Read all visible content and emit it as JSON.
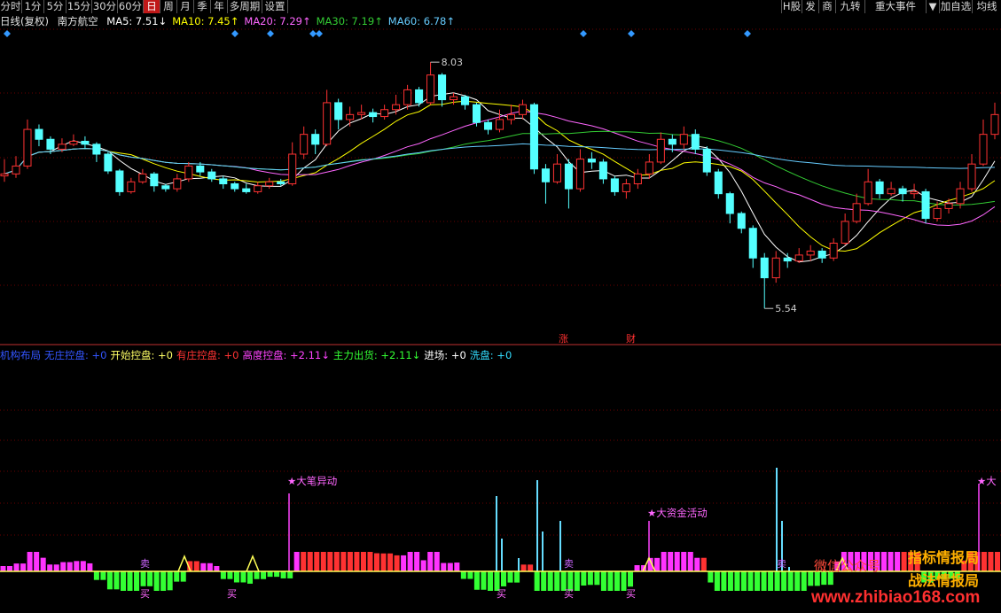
{
  "toolbar": {
    "left": [
      "分时",
      "1分",
      "5分",
      "15分",
      "30分",
      "60分",
      "日",
      "周",
      "月",
      "季",
      "年",
      "多周期",
      "设置"
    ],
    "active": "日",
    "right": [
      "H股",
      "发",
      "商",
      "九转",
      "重大事件",
      "▼",
      "加自选",
      "均线"
    ]
  },
  "ma_line": {
    "period": "日线(复权)",
    "stock": "南方航空",
    "items": [
      {
        "label": "MA5: 7.51↓",
        "color": "#ffffff"
      },
      {
        "label": "MA10: 7.45↑",
        "color": "#ffff00"
      },
      {
        "label": "MA20: 7.29↑",
        "color": "#ff66ff"
      },
      {
        "label": "MA30: 7.19↑",
        "color": "#33cc33"
      },
      {
        "label": "MA60: 6.78↑",
        "color": "#66ccff"
      }
    ]
  },
  "indicator_line": [
    {
      "label": "机构布局",
      "color": "#3355ff"
    },
    {
      "label": "无庄控盘: +0",
      "color": "#3355ff"
    },
    {
      "label": "开始控盘: +0",
      "color": "#ffff66"
    },
    {
      "label": "有庄控盘: +0",
      "color": "#ff3333"
    },
    {
      "label": "高度控盘: +2.11↓",
      "color": "#ff44ff"
    },
    {
      "label": "主力出货: +2.11↓",
      "color": "#33ff33"
    },
    {
      "label": "进场: +0",
      "color": "#ffffff"
    },
    {
      "label": "洗盘: +0",
      "color": "#33ddff"
    }
  ],
  "chart_data": {
    "type": "candlestick",
    "price_high_label": "8.03",
    "price_low_label": "5.54",
    "y_range": [
      5.3,
      8.3
    ],
    "colors": {
      "up": "#ff3232",
      "down": "#54ffff",
      "ma5": "#ffffff",
      "ma10": "#ffff00",
      "ma20": "#ff66ff",
      "ma30": "#33cc33",
      "ma60": "#66ccff"
    },
    "candles": [
      [
        6.88,
        6.9,
        7.05,
        6.82
      ],
      [
        6.9,
        6.98,
        7.08,
        6.86
      ],
      [
        6.98,
        7.35,
        7.45,
        6.95
      ],
      [
        7.35,
        7.25,
        7.4,
        7.18
      ],
      [
        7.25,
        7.15,
        7.28,
        7.1
      ],
      [
        7.15,
        7.2,
        7.26,
        7.12
      ],
      [
        7.2,
        7.23,
        7.3,
        7.18
      ],
      [
        7.23,
        7.2,
        7.28,
        7.15
      ],
      [
        7.2,
        7.1,
        7.22,
        7.02
      ],
      [
        7.1,
        6.93,
        7.12,
        6.9
      ],
      [
        6.93,
        6.72,
        6.95,
        6.68
      ],
      [
        6.72,
        6.82,
        6.86,
        6.7
      ],
      [
        6.82,
        6.9,
        6.95,
        6.8
      ],
      [
        6.9,
        6.78,
        6.92,
        6.72
      ],
      [
        6.78,
        6.75,
        6.8,
        6.72
      ],
      [
        6.75,
        6.85,
        6.9,
        6.72
      ],
      [
        6.85,
        6.98,
        7.02,
        6.82
      ],
      [
        6.98,
        6.92,
        7.02,
        6.88
      ],
      [
        6.92,
        6.85,
        6.95,
        6.82
      ],
      [
        6.85,
        6.8,
        6.88,
        6.75
      ],
      [
        6.8,
        6.75,
        6.82,
        6.72
      ],
      [
        6.75,
        6.72,
        6.8,
        6.7
      ],
      [
        6.72,
        6.78,
        6.82,
        6.7
      ],
      [
        6.78,
        6.82,
        6.86,
        6.75
      ],
      [
        6.82,
        6.8,
        6.85,
        6.78
      ],
      [
        6.8,
        7.1,
        7.22,
        6.78
      ],
      [
        7.1,
        7.3,
        7.38,
        7.05
      ],
      [
        7.3,
        7.2,
        7.35,
        7.1
      ],
      [
        7.2,
        7.62,
        7.75,
        7.18
      ],
      [
        7.62,
        7.45,
        7.66,
        7.35
      ],
      [
        7.45,
        7.5,
        7.58,
        7.38
      ],
      [
        7.5,
        7.52,
        7.6,
        7.45
      ],
      [
        7.52,
        7.48,
        7.56,
        7.42
      ],
      [
        7.48,
        7.55,
        7.6,
        7.45
      ],
      [
        7.55,
        7.6,
        7.7,
        7.5
      ],
      [
        7.6,
        7.75,
        7.8,
        7.55
      ],
      [
        7.75,
        7.62,
        7.78,
        7.58
      ],
      [
        7.62,
        7.9,
        8.03,
        7.6
      ],
      [
        7.9,
        7.65,
        7.92,
        7.58
      ],
      [
        7.65,
        7.68,
        7.72,
        7.6
      ],
      [
        7.68,
        7.6,
        7.7,
        7.55
      ],
      [
        7.6,
        7.42,
        7.62,
        7.38
      ],
      [
        7.42,
        7.35,
        7.45,
        7.3
      ],
      [
        7.35,
        7.45,
        7.55,
        7.32
      ],
      [
        7.45,
        7.5,
        7.6,
        7.4
      ],
      [
        7.5,
        7.6,
        7.65,
        7.45
      ],
      [
        7.6,
        6.95,
        7.62,
        6.9
      ],
      [
        6.95,
        6.82,
        7.0,
        6.6
      ],
      [
        6.82,
        7.0,
        7.1,
        6.8
      ],
      [
        7.0,
        6.75,
        7.05,
        6.55
      ],
      [
        6.75,
        7.05,
        7.15,
        6.72
      ],
      [
        7.05,
        7.02,
        7.12,
        6.95
      ],
      [
        7.02,
        6.85,
        7.05,
        6.8
      ],
      [
        6.85,
        6.72,
        6.88,
        6.68
      ],
      [
        6.72,
        6.8,
        6.85,
        6.65
      ],
      [
        6.8,
        6.9,
        6.95,
        6.75
      ],
      [
        6.9,
        7.02,
        7.1,
        6.85
      ],
      [
        7.02,
        7.25,
        7.32,
        7.0
      ],
      [
        7.25,
        7.2,
        7.3,
        7.12
      ],
      [
        7.2,
        7.3,
        7.38,
        7.15
      ],
      [
        7.3,
        7.15,
        7.35,
        7.1
      ],
      [
        7.15,
        6.92,
        7.18,
        6.88
      ],
      [
        6.92,
        6.7,
        6.95,
        6.65
      ],
      [
        6.7,
        6.5,
        6.72,
        6.4
      ],
      [
        6.5,
        6.35,
        6.52,
        6.3
      ],
      [
        6.35,
        6.05,
        6.38,
        5.95
      ],
      [
        6.05,
        5.85,
        6.1,
        5.54
      ],
      [
        5.85,
        6.05,
        6.12,
        5.8
      ],
      [
        6.05,
        6.02,
        6.1,
        5.95
      ],
      [
        6.02,
        6.08,
        6.15,
        6.0
      ],
      [
        6.08,
        6.12,
        6.18,
        6.02
      ],
      [
        6.12,
        6.05,
        6.15,
        6.0
      ],
      [
        6.05,
        6.2,
        6.25,
        6.02
      ],
      [
        6.2,
        6.42,
        6.5,
        6.18
      ],
      [
        6.42,
        6.6,
        6.7,
        6.4
      ],
      [
        6.6,
        6.82,
        6.95,
        6.58
      ],
      [
        6.82,
        6.7,
        6.85,
        6.65
      ],
      [
        6.7,
        6.75,
        6.82,
        6.68
      ],
      [
        6.75,
        6.7,
        6.78,
        6.62
      ],
      [
        6.7,
        6.72,
        6.8,
        6.65
      ],
      [
        6.72,
        6.45,
        6.75,
        6.4
      ],
      [
        6.45,
        6.55,
        6.62,
        6.42
      ],
      [
        6.55,
        6.6,
        6.65,
        6.5
      ],
      [
        6.6,
        6.75,
        6.82,
        6.55
      ],
      [
        6.75,
        7.0,
        7.1,
        6.72
      ],
      [
        7.0,
        7.3,
        7.45,
        6.98
      ],
      [
        7.3,
        7.5,
        7.62,
        7.25
      ]
    ],
    "signals": {
      "sell": [
        "卖",
        "卖",
        "卖"
      ],
      "buy": [
        "买",
        "买",
        "买",
        "买",
        "买"
      ],
      "cai": [
        "财"
      ],
      "zhang": [
        "涨"
      ]
    },
    "vol_labels": [
      "★大笔异动",
      "★大资金活动",
      "★大"
    ]
  },
  "watermark": {
    "line1": "指标情报局",
    "line2": "战法情报局",
    "wechat": "微信公众号",
    "url": "www.zhibiao168.com"
  }
}
